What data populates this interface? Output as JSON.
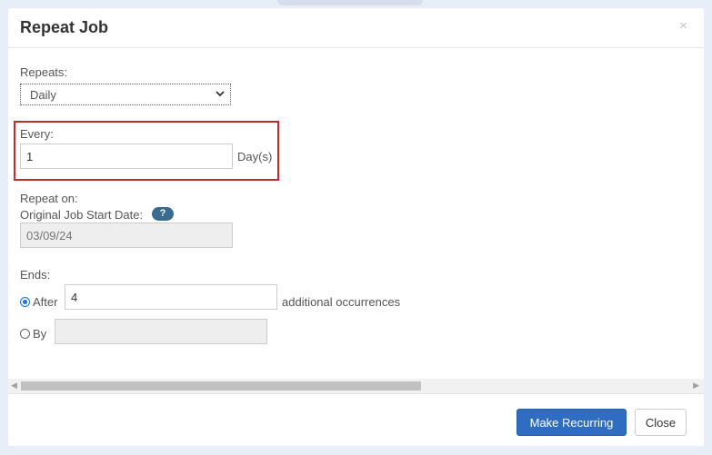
{
  "modal": {
    "title": "Repeat Job",
    "close_glyph": "×"
  },
  "repeats": {
    "label": "Repeats:",
    "selected": "Daily"
  },
  "every": {
    "label": "Every:",
    "value": "1",
    "unit": "Day(s)"
  },
  "repeat_on": {
    "label": "Repeat on:",
    "start_label": "Original Job Start Date:",
    "help_glyph": "?",
    "start_value": "03/09/24"
  },
  "ends": {
    "label": "Ends:",
    "after_label": "After",
    "after_value": "4",
    "after_suffix": "additional occurrences",
    "by_label": "By",
    "by_value": ""
  },
  "footer": {
    "primary_label": "Make Recurring",
    "close_label": "Close"
  },
  "colors": {
    "primary": "#2f6dc2",
    "highlight": "#c12b2b",
    "help_badge": "#3a6b8e"
  }
}
